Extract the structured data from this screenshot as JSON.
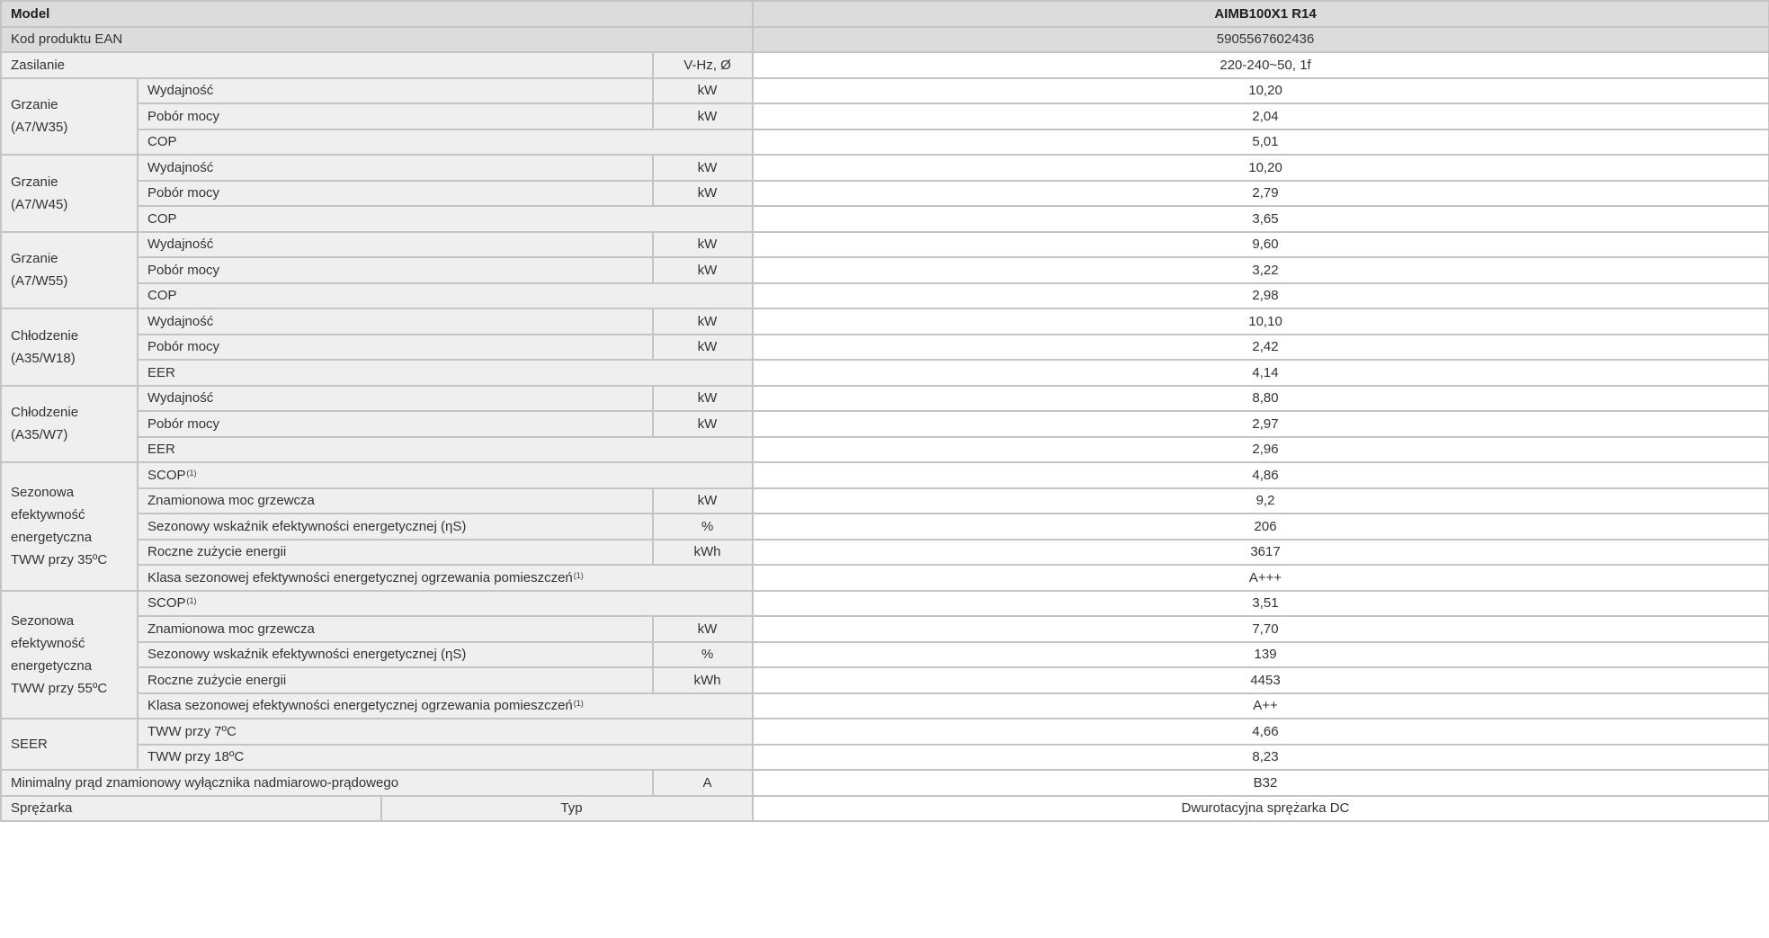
{
  "header": {
    "model_label": "Model",
    "model_value": "AIMB100X1 R14"
  },
  "ean": {
    "label": "Kod produktu EAN",
    "value": "5905567602436"
  },
  "power_supply": {
    "label": "Zasilanie",
    "unit": "V-Hz, Ø",
    "value": "220-240~50, 1f"
  },
  "groups": [
    {
      "label_line1": "Grzanie",
      "label_line2": "(A7/W35)",
      "rows": [
        {
          "label": "Wydajność",
          "unit": "kW",
          "value": "10,20"
        },
        {
          "label": "Pobór mocy",
          "unit": "kW",
          "value": "2,04"
        },
        {
          "label": "COP",
          "value": "5,01"
        }
      ]
    },
    {
      "label_line1": "Grzanie",
      "label_line2": "(A7/W45)",
      "rows": [
        {
          "label": "Wydajność",
          "unit": "kW",
          "value": "10,20"
        },
        {
          "label": "Pobór mocy",
          "unit": "kW",
          "value": "2,79"
        },
        {
          "label": "COP",
          "value": "3,65"
        }
      ]
    },
    {
      "label_line1": "Grzanie",
      "label_line2": "(A7/W55)",
      "rows": [
        {
          "label": "Wydajność",
          "unit": "kW",
          "value": "9,60"
        },
        {
          "label": "Pobór mocy",
          "unit": "kW",
          "value": "3,22"
        },
        {
          "label": "COP",
          "value": "2,98"
        }
      ]
    },
    {
      "label_line1": "Chłodzenie",
      "label_line2": "(A35/W18)",
      "rows": [
        {
          "label": "Wydajność",
          "unit": "kW",
          "value": "10,10"
        },
        {
          "label": "Pobór mocy",
          "unit": "kW",
          "value": "2,42"
        },
        {
          "label": "EER",
          "value": "4,14"
        }
      ]
    },
    {
      "label_line1": "Chłodzenie",
      "label_line2": "(A35/W7)",
      "rows": [
        {
          "label": "Wydajność",
          "unit": "kW",
          "value": "8,80"
        },
        {
          "label": "Pobór mocy",
          "unit": "kW",
          "value": "2,97"
        },
        {
          "label": "EER",
          "value": "2,96"
        }
      ]
    }
  ],
  "seasonal_35": {
    "lines": [
      "Sezonowa",
      "efektywność",
      "energetyczna",
      "TWW przy 35ºC"
    ],
    "scop_label": "SCOP",
    "scop_sup": "(1)",
    "scop_value": "4,86",
    "rated_label": "Znamionowa moc grzewcza",
    "rated_unit": "kW",
    "rated_value": "9,2",
    "ns_label": "Sezonowy wskaźnik efektywności energetycznej (ηS)",
    "ns_unit": "%",
    "ns_value": "206",
    "annual_label": "Roczne zużycie energii",
    "annual_unit": "kWh",
    "annual_value": "3617",
    "class_label": "Klasa sezonowej efektywności energetycznej ogrzewania pomieszczeń",
    "class_sup": "(1)",
    "class_value": "A+++"
  },
  "seasonal_55": {
    "lines": [
      "Sezonowa",
      "efektywność",
      "energetyczna",
      "TWW przy 55ºC"
    ],
    "scop_label": "SCOP",
    "scop_sup": "(1)",
    "scop_value": "3,51",
    "rated_label": "Znamionowa moc grzewcza",
    "rated_unit": "kW",
    "rated_value": "7,70",
    "ns_label": "Sezonowy wskaźnik efektywności energetycznej (ηS)",
    "ns_unit": "%",
    "ns_value": "139",
    "annual_label": "Roczne zużycie energii",
    "annual_unit": "kWh",
    "annual_value": "4453",
    "class_label": "Klasa sezonowej efektywności energetycznej ogrzewania pomieszczeń",
    "class_sup": "(1)",
    "class_value": "A++"
  },
  "seer": {
    "label": "SEER",
    "rows": [
      {
        "label": "TWW przy 7ºC",
        "value": "4,66"
      },
      {
        "label": "TWW przy 18ºC",
        "value": "8,23"
      }
    ]
  },
  "breaker": {
    "label": "Minimalny prąd znamionowy wyłącznika nadmiarowo-prądowego",
    "unit": "A",
    "value": "B32"
  },
  "compressor": {
    "label": "Sprężarka",
    "type_label": "Typ",
    "value": "Dwurotacyjna sprężarka DC"
  }
}
